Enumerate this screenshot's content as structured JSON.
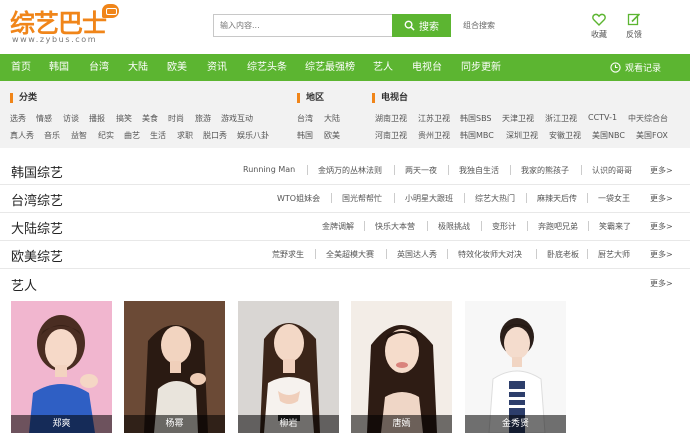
{
  "logo": {
    "title": "综艺巴士",
    "url": "www.zybus.com"
  },
  "search": {
    "placeholder": "输入内容...",
    "button_label": "搜索",
    "combo_label": "组合搜索"
  },
  "header_links": {
    "favorites": "收藏",
    "feedback": "反馈"
  },
  "nav": {
    "items": [
      "首页",
      "韩国",
      "台湾",
      "大陆",
      "欧美",
      "资讯",
      "综艺头条",
      "综艺最强榜",
      "艺人",
      "电视台",
      "同步更新"
    ],
    "history": "观看记录"
  },
  "filters": {
    "category": {
      "title": "分类",
      "row1": [
        "选秀",
        "情感",
        "访谈",
        "播报",
        "搞笑",
        "美食",
        "时尚",
        "旅游",
        "游戏互动"
      ],
      "row2": [
        "真人秀",
        "音乐",
        "益智",
        "纪实",
        "曲艺",
        "生活",
        "求职",
        "脱口秀",
        "娱乐八卦"
      ]
    },
    "region": {
      "title": "地区",
      "row1": [
        "台湾",
        "大陆"
      ],
      "row2": [
        "韩国",
        "欧美"
      ]
    },
    "tv": {
      "title": "电视台",
      "row1": [
        "湖南卫视",
        "江苏卫视",
        "韩国SBS",
        "天津卫视",
        "浙江卫视",
        "CCTV-1",
        "中天综合台"
      ],
      "row2": [
        "河南卫视",
        "贵州卫视",
        "韩国MBC",
        "深圳卫视",
        "安徽卫视",
        "美国NBC",
        "美国FOX"
      ]
    }
  },
  "rows": [
    {
      "title": "韩国综艺",
      "links": [
        "Running Man",
        "金炳万的丛林法则",
        "两天一夜",
        "我独自生活",
        "我家的熊孩子",
        "认识的哥哥"
      ],
      "more": "更多>"
    },
    {
      "title": "台湾综艺",
      "links": [
        "WTO姐妹会",
        "国光帮帮忙",
        "小明星大跟班",
        "综艺大热门",
        "麻辣天后传",
        "一袋女王"
      ],
      "more": "更多>"
    },
    {
      "title": "大陆综艺",
      "links": [
        "金牌调解",
        "快乐大本营",
        "极限挑战",
        "变形计",
        "奔跑吧兄弟",
        "笑霸来了"
      ],
      "more": "更多>"
    },
    {
      "title": "欧美综艺",
      "links": [
        "荒野求生",
        "全美超模大赛",
        "英国达人秀",
        "特效化妆师大对决",
        "卧底老板",
        "厨艺大师"
      ],
      "more": "更多>"
    },
    {
      "title": "艺人",
      "links": [],
      "more": "更多>"
    }
  ],
  "artists": [
    {
      "name": "郑爽"
    },
    {
      "name": "杨幂"
    },
    {
      "name": "柳岩"
    },
    {
      "name": "唐嫣"
    },
    {
      "name": "金秀贤"
    }
  ],
  "colors": {
    "brand_green": "#5cb531",
    "logo_orange": "#f08519",
    "filter_bg": "#f2f2f2"
  },
  "icons": {
    "search": "search-icon",
    "favorites": "heart-icon",
    "feedback": "edit-icon",
    "history": "clock-icon"
  }
}
